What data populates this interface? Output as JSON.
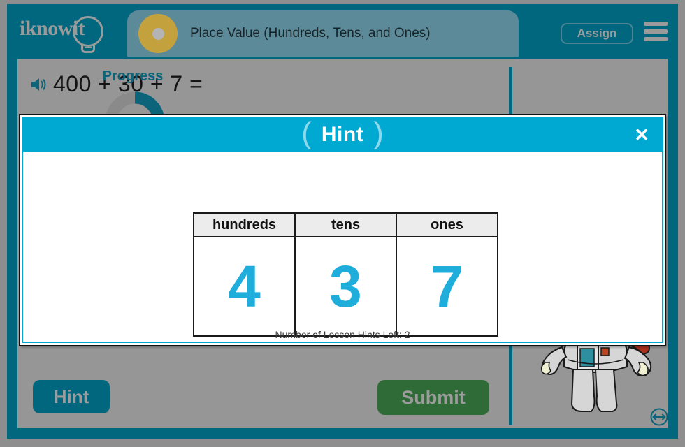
{
  "header": {
    "logo_text": "iknowit",
    "logo_icon": "lightbulb-icon",
    "lesson_title": "Place Value (Hundreds, Tens, and Ones)",
    "assign_label": "Assign",
    "menu_icon": "hamburger-menu-icon"
  },
  "question": {
    "speaker_icon": "speaker-audio-icon",
    "text": "400 + 30 + 7 ="
  },
  "progress": {
    "label": "Progress",
    "percent": 25,
    "ring_color": "#0b647a",
    "track_color": "#8a8a8a"
  },
  "actions": {
    "hint_label": "Hint",
    "submit_label": "Submit",
    "resize_icon": "resize-horizontal-icon",
    "mascot_icon": "astronaut-mascot"
  },
  "modal": {
    "title": "Hint",
    "open_paren": "(",
    "close_paren": ")",
    "close_icon": "✕",
    "hints_left_text": "Number of Lesson Hints Left: 2",
    "header_color": "#00a9d2",
    "digit_color": "#1faedb",
    "table": {
      "headers": [
        "hundreds",
        "tens",
        "ones"
      ],
      "values": [
        "4",
        "3",
        "7"
      ]
    }
  },
  "colors": {
    "frame_teal": "#00677e",
    "panel_gray": "#969696",
    "title_pill": "#5d8a99",
    "gold": "#c3a23e",
    "submit_green": "#2f6b37"
  }
}
